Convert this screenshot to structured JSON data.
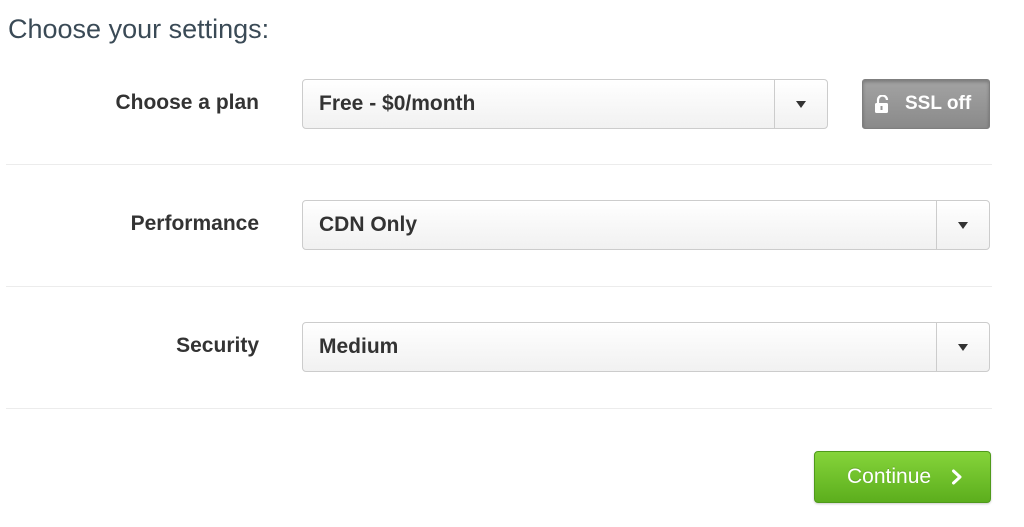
{
  "heading": "Choose your settings:",
  "rows": [
    {
      "label": "Choose a plan",
      "value": "Free - $0/month"
    },
    {
      "label": "Performance",
      "value": "CDN Only"
    },
    {
      "label": "Security",
      "value": "Medium"
    }
  ],
  "ssl_button": {
    "label": "SSL off",
    "icon": "unlocked-padlock-icon"
  },
  "continue_button": {
    "label": "Continue",
    "icon": "chevron-right-icon"
  },
  "colors": {
    "heading": "#3a4a56",
    "continue_green": "#6cbf27",
    "ssl_gray": "#959595"
  }
}
